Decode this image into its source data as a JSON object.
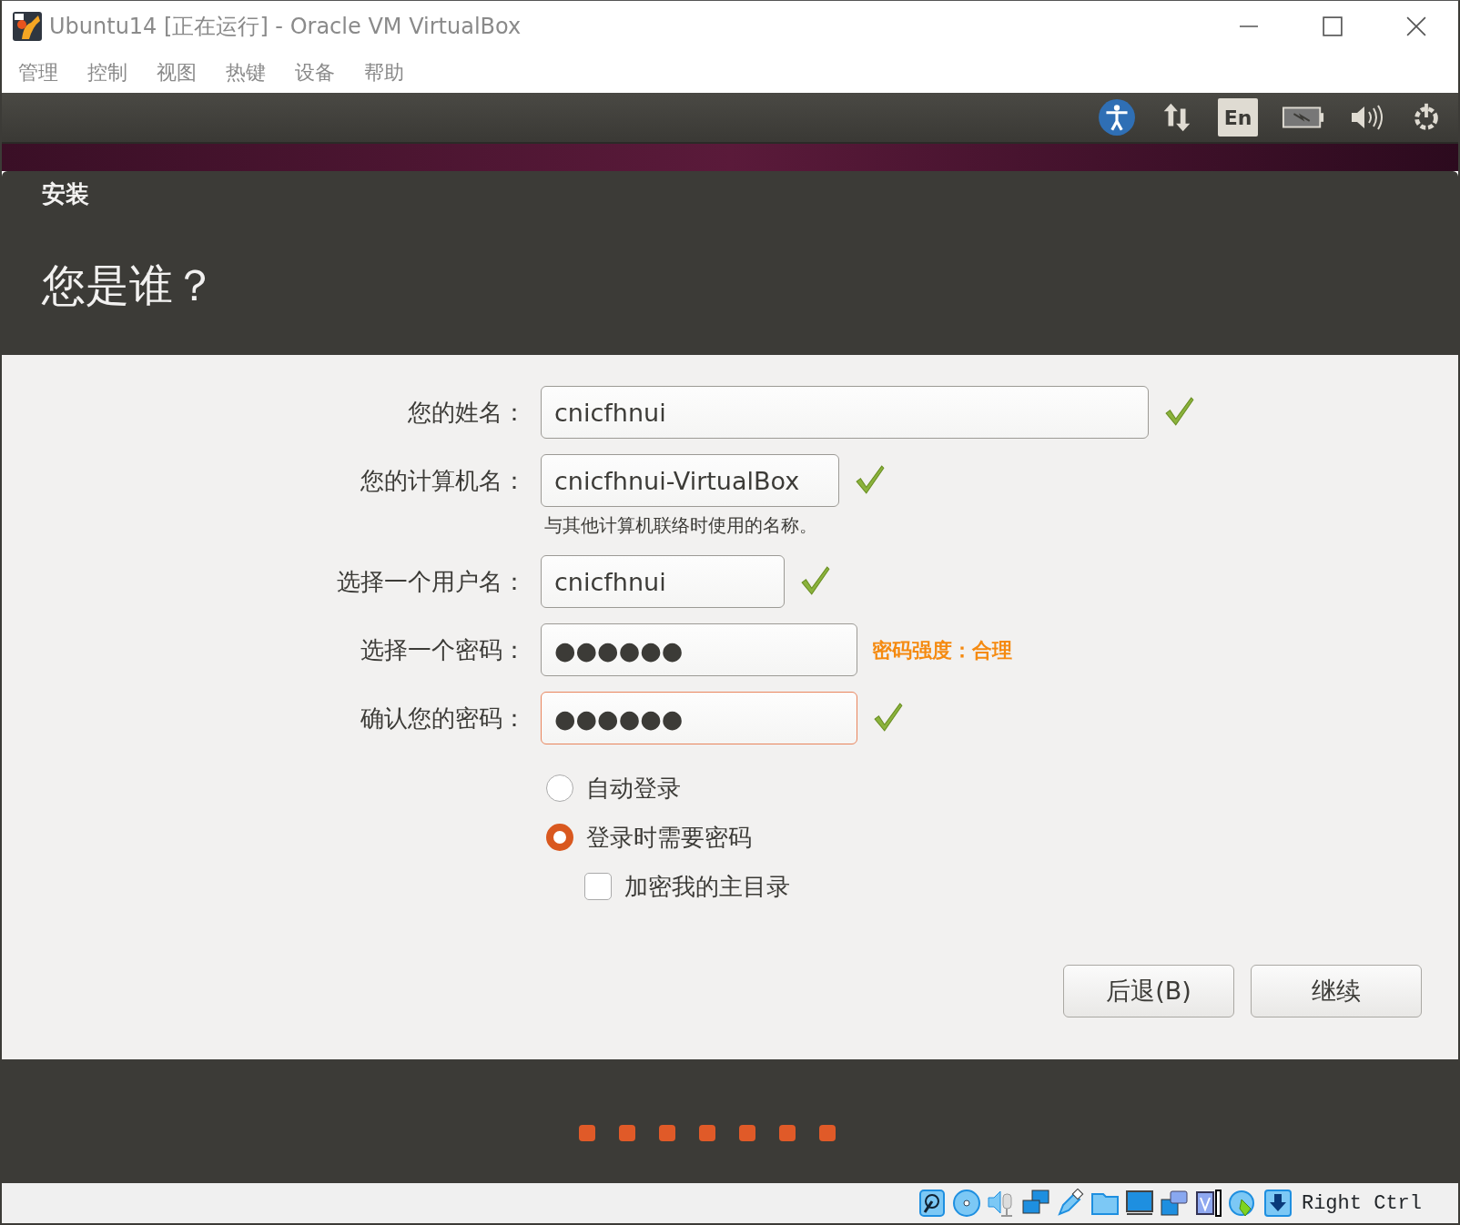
{
  "window": {
    "title": "Ubuntu14 [正在运行] - Oracle VM VirtualBox"
  },
  "menu": [
    "管理",
    "控制",
    "视图",
    "热键",
    "设备",
    "帮助"
  ],
  "panel": {
    "language": "En"
  },
  "installer": {
    "caption": "安装",
    "heading": "您是谁？",
    "fields": [
      {
        "label": "您的姓名：",
        "value": "cnicfhnui",
        "valid": true,
        "focused": false
      },
      {
        "label": "您的计算机名：",
        "value": "cnicfhnui-VirtualBox",
        "valid": true,
        "focused": false,
        "hint": "与其他计算机联络时使用的名称。"
      },
      {
        "label": "选择一个用户名：",
        "value": "cnicfhnui",
        "valid": true,
        "focused": false
      },
      {
        "label": "选择一个密码：",
        "value": "●●●●●●",
        "valid": false,
        "focused": false,
        "strength": "密码强度：合理"
      },
      {
        "label": "确认您的密码：",
        "value": "●●●●●●",
        "valid": true,
        "focused": true
      }
    ],
    "options": [
      {
        "kind": "radio",
        "label": "自动登录",
        "selected": false
      },
      {
        "kind": "radio",
        "label": "登录时需要密码",
        "selected": true,
        "children": [
          {
            "kind": "checkbox",
            "label": "加密我的主目录",
            "checked": false
          }
        ]
      }
    ],
    "buttons": [
      "后退(B)",
      "继续"
    ]
  },
  "status_bar": {
    "host_key": "Right Ctrl"
  }
}
